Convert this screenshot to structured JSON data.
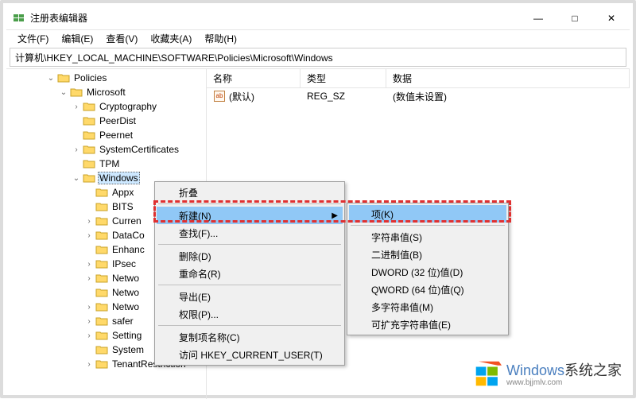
{
  "window": {
    "title": "注册表编辑器",
    "min": "—",
    "max": "□",
    "close": "✕"
  },
  "menu": {
    "file": "文件(F)",
    "edit": "编辑(E)",
    "view": "查看(V)",
    "favorites": "收藏夹(A)",
    "help": "帮助(H)"
  },
  "address": "计算机\\HKEY_LOCAL_MACHINE\\SOFTWARE\\Policies\\Microsoft\\Windows",
  "columns": {
    "name": "名称",
    "type": "类型",
    "data": "数据"
  },
  "value_row": {
    "name": "(默认)",
    "type": "REG_SZ",
    "data": "(数值未设置)"
  },
  "tree": {
    "policies": "Policies",
    "microsoft": "Microsoft",
    "cryptography": "Cryptography",
    "peerdist": "PeerDist",
    "peernet": "Peernet",
    "systemcertificates": "SystemCertificates",
    "tpm": "TPM",
    "windows": "Windows",
    "appx": "Appx",
    "bits": "BITS",
    "curren": "Curren",
    "dataco": "DataCo",
    "enhanc": "Enhanc",
    "ipsec": "IPsec",
    "netwo1": "Netwo",
    "netwo2": "Netwo",
    "netwo3": "Netwo",
    "safer": "safer",
    "setting": "Setting",
    "system": "System",
    "tenantrestriction": "TenantRestriction"
  },
  "ctx1": {
    "collapse": "折叠",
    "new": "新建(N)",
    "find": "查找(F)...",
    "delete": "删除(D)",
    "rename": "重命名(R)",
    "export": "导出(E)",
    "permissions": "权限(P)...",
    "copykey": "复制项名称(C)",
    "goto": "访问 HKEY_CURRENT_USER(T)"
  },
  "ctx2": {
    "key": "项(K)",
    "string": "字符串值(S)",
    "binary": "二进制值(B)",
    "dword": "DWORD (32 位)值(D)",
    "qword": "QWORD (64 位)值(Q)",
    "multistring": "多字符串值(M)",
    "expandstring": "可扩充字符串值(E)"
  },
  "watermark": {
    "brand": "Windows",
    "suffix": "系统之家",
    "url": "www.bjjmlv.com"
  }
}
